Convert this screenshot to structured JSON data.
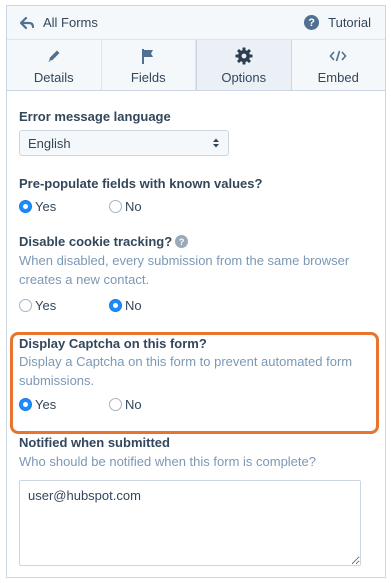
{
  "header": {
    "back_label": "All Forms",
    "tutorial_label": "Tutorial",
    "back_icon": "back-arrow-icon",
    "help_icon": "help-circle-icon"
  },
  "tabs": [
    {
      "label": "Details",
      "icon": "pencil-icon",
      "active": false
    },
    {
      "label": "Fields",
      "icon": "flag-icon",
      "active": false
    },
    {
      "label": "Options",
      "icon": "gear-icon",
      "active": true
    },
    {
      "label": "Embed",
      "icon": "code-icon",
      "active": false
    }
  ],
  "options": {
    "error_language": {
      "label": "Error message language",
      "value": "English"
    },
    "prepopulate": {
      "label": "Pre-populate fields with known values?",
      "yes": "Yes",
      "no": "No",
      "selected": "yes"
    },
    "cookie": {
      "label": "Disable cookie tracking?",
      "description": "When disabled, every submission from the same browser creates a new contact.",
      "yes": "Yes",
      "no": "No",
      "selected": "no"
    },
    "captcha": {
      "label": "Display Captcha on this form?",
      "description": "Display a Captcha on this form to prevent automated form submissions.",
      "yes": "Yes",
      "no": "No",
      "selected": "yes"
    },
    "notified": {
      "label": "Notified when submitted",
      "description": "Who should be notified when this form is complete?",
      "value": "user@hubspot.com"
    }
  },
  "colors": {
    "highlight": "#e8742d",
    "radio_checked": "#1a8cff",
    "text": "#33475b",
    "muted": "#7c98b6"
  }
}
